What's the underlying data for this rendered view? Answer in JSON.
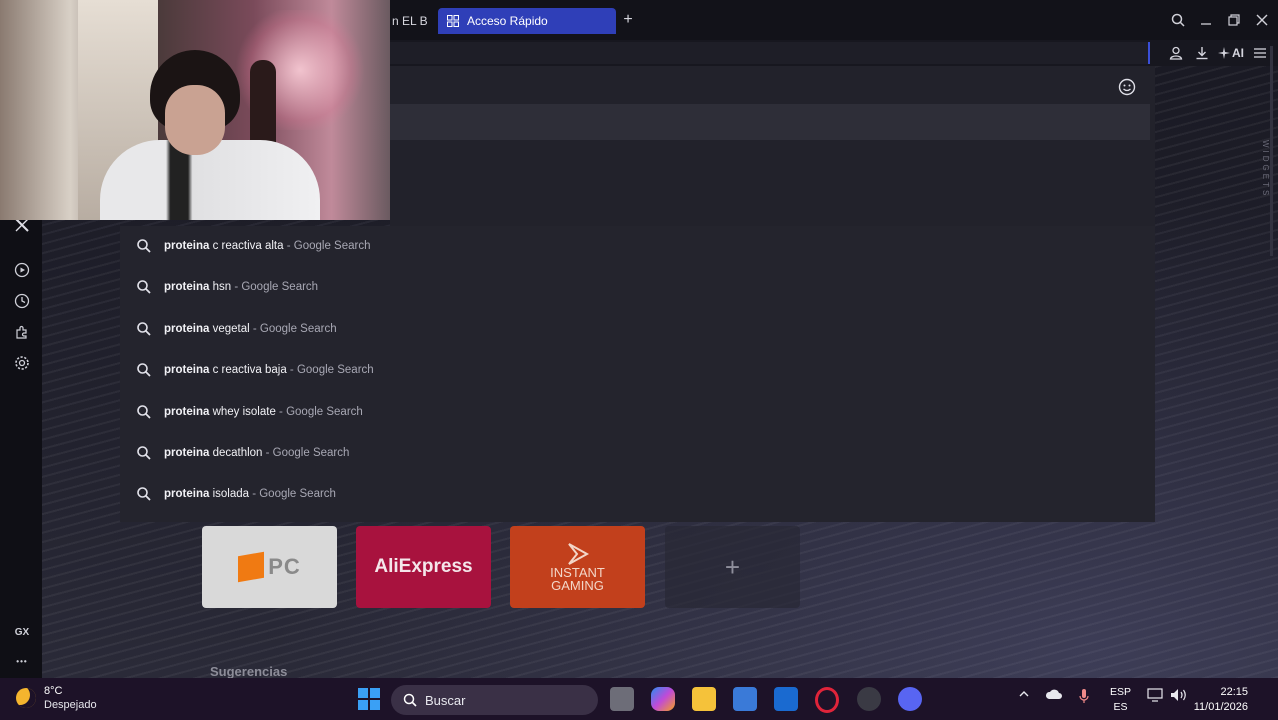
{
  "tabs": {
    "previous_tab_title": "n EL B",
    "active_tab_title": "Acceso Rápido",
    "new_tab_symbol": "+"
  },
  "toolbar": {
    "ai_label": "AI"
  },
  "sidebar": {
    "gx_label": "GX",
    "more_label": "•••"
  },
  "suggestions": [
    {
      "query": "proteina",
      "rest": " c reactiva alta",
      "engine": " - Google Search"
    },
    {
      "query": "proteina",
      "rest": " hsn",
      "engine": " - Google Search"
    },
    {
      "query": "proteina",
      "rest": " vegetal",
      "engine": " - Google Search"
    },
    {
      "query": "proteina",
      "rest": " c reactiva baja",
      "engine": " - Google Search"
    },
    {
      "query": "proteina",
      "rest": " whey isolate",
      "engine": " - Google Search"
    },
    {
      "query": "proteina",
      "rest": " decathlon",
      "engine": " - Google Search"
    },
    {
      "query": "proteina",
      "rest": " isolada",
      "engine": " - Google Search"
    }
  ],
  "speed_dial": {
    "pc_label": "PC",
    "aliexpress_label": "AliExpress",
    "instant_gaming_line1": "INSTANT",
    "instant_gaming_line2": "GAMING",
    "add_symbol": "+",
    "suggestions_heading": "Sugerencias"
  },
  "widgets_label": "WIDGETS",
  "taskbar": {
    "temperature": "8°C",
    "condition": "Despejado",
    "search_placeholder": "Buscar",
    "lang_top": "ESP",
    "lang_bottom": "ES",
    "time": "22:15",
    "date": "11/01/2026"
  },
  "colors": {
    "accent": "#2f3fb8",
    "opera_red": "#e0243a",
    "aliexpress": "#a8123e",
    "instant_gaming": "#c2401c"
  }
}
